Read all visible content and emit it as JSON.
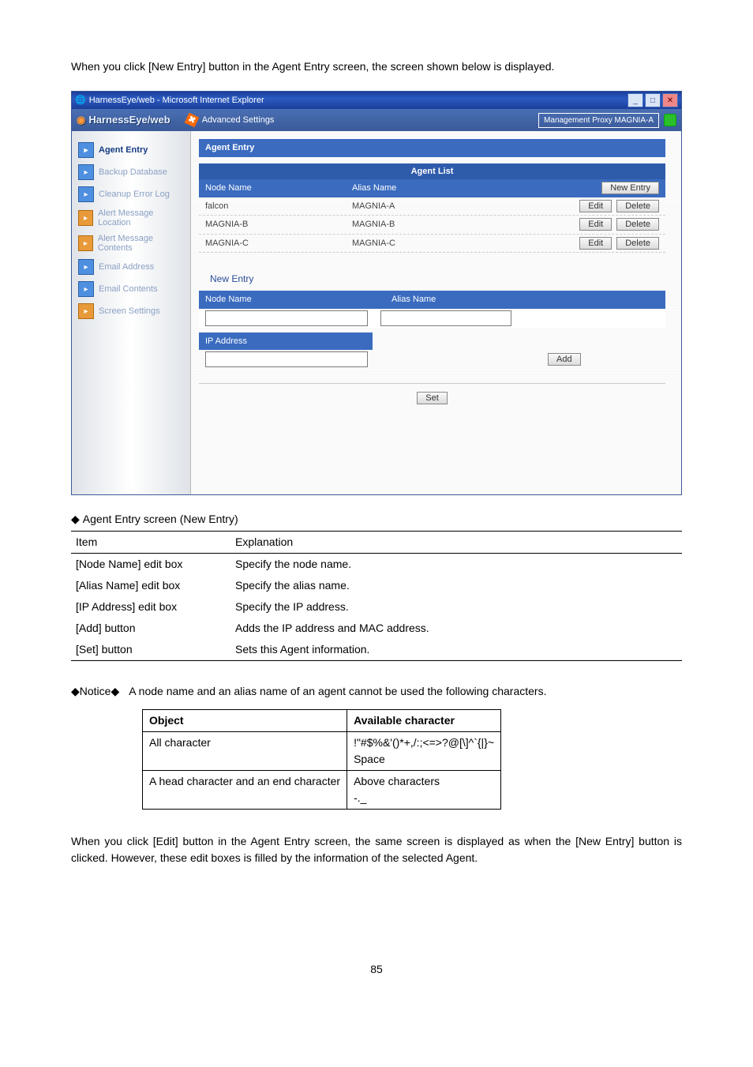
{
  "intro": "When you click [New Entry] button in the Agent Entry screen, the screen shown below is displayed.",
  "ie": {
    "title": "HarnessEye/web - Microsoft Internet Explorer"
  },
  "app": {
    "logo_part1": "HarnessEye",
    "logo_part2": "/web",
    "advanced": "Advanced Settings",
    "proxy_label": "Management Proxy",
    "proxy_value": "MAGNIA-A"
  },
  "sidebar": [
    {
      "label": "Agent Entry",
      "icon": "pencil",
      "active": true
    },
    {
      "label": "Backup Database",
      "icon": "db"
    },
    {
      "label": "Cleanup Error Log",
      "icon": "eraser"
    },
    {
      "label": "Alert Message Location",
      "icon": "bell-o"
    },
    {
      "label": "Alert Message Contents",
      "icon": "bell-o"
    },
    {
      "label": "Email Address",
      "icon": "mail"
    },
    {
      "label": "Email Contents",
      "icon": "mail"
    },
    {
      "label": "Screen Settings",
      "icon": "screen-o"
    }
  ],
  "panel": {
    "title": "Agent Entry",
    "list_header": "Agent List",
    "col_node": "Node Name",
    "col_alias": "Alias Name",
    "new_entry_btn": "New Entry",
    "edit_btn": "Edit",
    "delete_btn": "Delete",
    "rows": [
      {
        "node": "falcon",
        "alias": "MAGNIA-A"
      },
      {
        "node": "MAGNIA-B",
        "alias": "MAGNIA-B"
      },
      {
        "node": "MAGNIA-C",
        "alias": "MAGNIA-C"
      }
    ],
    "form_section": "New Entry",
    "form_node": "Node Name",
    "form_alias": "Alias Name",
    "form_ip": "IP Address",
    "add_btn": "Add",
    "set_btn": "Set"
  },
  "table1": {
    "caption": "Agent Entry screen (New Entry)",
    "h1": "Item",
    "h2": "Explanation",
    "rows": [
      {
        "a": "[Node Name] edit box",
        "b": "Specify the node name."
      },
      {
        "a": "[Alias Name] edit box",
        "b": "Specify the alias name."
      },
      {
        "a": "[IP Address] edit box",
        "b": "Specify the IP address."
      },
      {
        "a": "[Add] button",
        "b": "Adds the IP address and MAC address."
      },
      {
        "a": "[Set] button",
        "b": "Sets this Agent information."
      }
    ]
  },
  "notice": {
    "label": "◆Notice◆",
    "text": "A node name and an alias name of an agent cannot be used the following characters."
  },
  "chartbl": {
    "h1": "Object",
    "h2": "Available character",
    "r1a": "All character",
    "r1b": "!\"#$%&'()*+,/:;<=>?@[\\]^`{|}~\nSpace",
    "r2a": "A head character and an end character",
    "r2b": "Above characters\n-._"
  },
  "bottom": "When you click [Edit] button in the Agent Entry screen, the same screen is displayed as when the [New Entry] button is clicked. However, these edit boxes is filled by the information of the selected Agent.",
  "pagenum": "85"
}
